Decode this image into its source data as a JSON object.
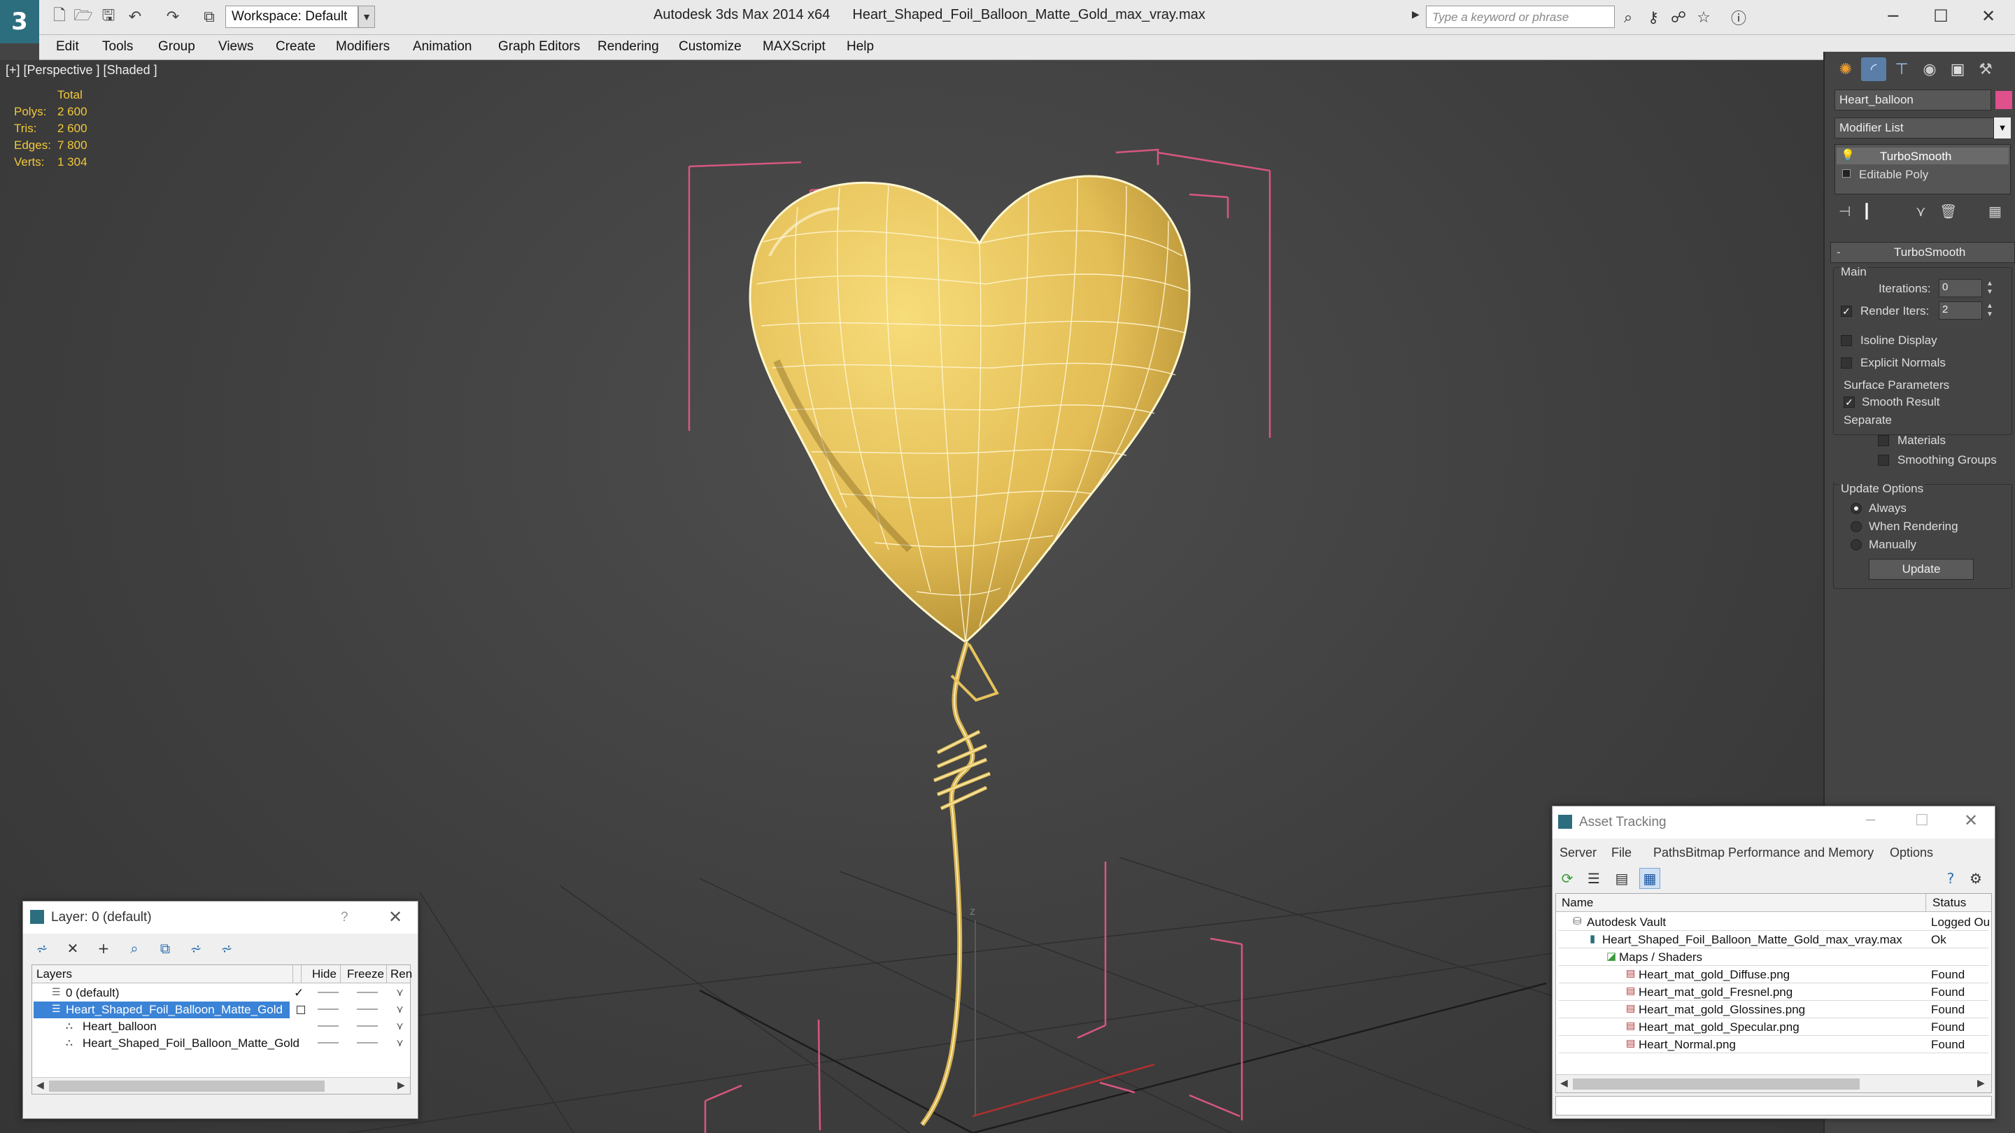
{
  "titlebar": {
    "app_name": "Autodesk 3ds Max 2014 x64",
    "file_name": "Heart_Shaped_Foil_Balloon_Matte_Gold_max_vray.max",
    "workspace": "Workspace: Default",
    "search_placeholder": "Type a keyword or phrase"
  },
  "menubar": {
    "items": [
      "Edit",
      "Tools",
      "Group",
      "Views",
      "Create",
      "Modifiers",
      "Animation",
      "Graph Editors",
      "Rendering",
      "Customize",
      "MAXScript",
      "Help"
    ]
  },
  "viewport": {
    "label": "[+] [Perspective ] [Shaded ]",
    "stats": {
      "header": "Total",
      "rows": [
        {
          "label": "Polys:",
          "value": "2 600"
        },
        {
          "label": "Tris:",
          "value": "2 600"
        },
        {
          "label": "Edges:",
          "value": "7 800"
        },
        {
          "label": "Verts:",
          "value": "1 304"
        }
      ]
    },
    "axis_label": "z",
    "balloon_color": "#e6c35c",
    "wire_color": "#fff6d0",
    "bbox_color": "#d8577e"
  },
  "command_panel": {
    "object_name": "Heart_balloon",
    "object_color": "#e0508a",
    "modifier_list": "Modifier List",
    "stack": [
      "TurboSmooth",
      "Editable Poly"
    ],
    "rollout_title": "TurboSmooth",
    "main_label": "Main",
    "iterations_label": "Iterations:",
    "iterations_value": "0",
    "render_iters_label": "Render Iters:",
    "render_iters_value": "2",
    "isoline_label": "Isoline Display",
    "explicit_normals_label": "Explicit Normals",
    "surface_params_label": "Surface Parameters",
    "smooth_result_label": "Smooth Result",
    "separate_label": "Separate",
    "materials_label": "Materials",
    "smoothing_groups_label": "Smoothing Groups",
    "update_options_label": "Update Options",
    "always_label": "Always",
    "when_rendering_label": "When Rendering",
    "manually_label": "Manually",
    "update_button": "Update"
  },
  "layer_dialog": {
    "title": "Layer: 0 (default)",
    "help": "?",
    "columns": [
      "Layers",
      "Hide",
      "Freeze",
      "Ren"
    ],
    "rows": [
      {
        "name": "0 (default)",
        "indent": 0,
        "selected": false
      },
      {
        "name": "Heart_Shaped_Foil_Balloon_Matte_Gold",
        "indent": 0,
        "selected": true
      },
      {
        "name": "Heart_balloon",
        "indent": 1,
        "selected": false
      },
      {
        "name": "Heart_Shaped_Foil_Balloon_Matte_Gold",
        "indent": 1,
        "selected": false
      }
    ]
  },
  "asset_dialog": {
    "title": "Asset Tracking",
    "menu": [
      "Server",
      "File",
      "Paths",
      "Bitmap Performance and Memory",
      "Options"
    ],
    "columns": [
      "Name",
      "Status"
    ],
    "rows": [
      {
        "name": "Autodesk Vault",
        "status": "Logged Ou",
        "indent": 0
      },
      {
        "name": "Heart_Shaped_Foil_Balloon_Matte_Gold_max_vray.max",
        "status": "Ok",
        "indent": 1
      },
      {
        "name": "Maps / Shaders",
        "status": "",
        "indent": 2
      },
      {
        "name": "Heart_mat_gold_Diffuse.png",
        "status": "Found",
        "indent": 3
      },
      {
        "name": "Heart_mat_gold_Fresnel.png",
        "status": "Found",
        "indent": 3
      },
      {
        "name": "Heart_mat_gold_Glossines.png",
        "status": "Found",
        "indent": 3
      },
      {
        "name": "Heart_mat_gold_Specular.png",
        "status": "Found",
        "indent": 3
      },
      {
        "name": "Heart_Normal.png",
        "status": "Found",
        "indent": 3
      }
    ]
  }
}
